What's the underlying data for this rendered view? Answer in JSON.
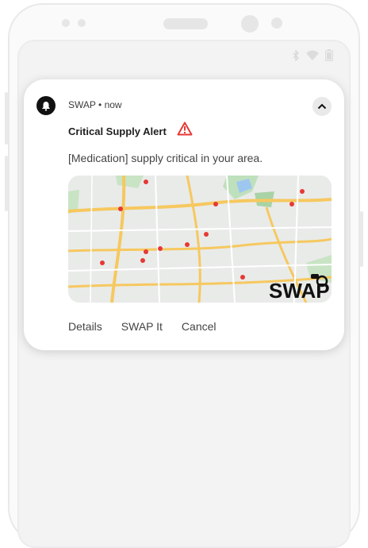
{
  "notification": {
    "app_name": "SWAP",
    "time": "• now",
    "title": "Critical Supply Alert",
    "message": "[Medication] supply critical in your area.",
    "actions": [
      "Details",
      "SWAP It",
      "Cancel"
    ],
    "icons": {
      "app": "bell-icon",
      "collapse": "chevron-up-icon",
      "alert": "warning-triangle-icon",
      "status": [
        "bluetooth-icon",
        "wifi-icon",
        "battery-icon"
      ]
    },
    "map_logo_text": "SWAP",
    "colors": {
      "alert": "#e53935",
      "app_icon_bg": "#111111",
      "map_pin": "#e53935"
    }
  }
}
